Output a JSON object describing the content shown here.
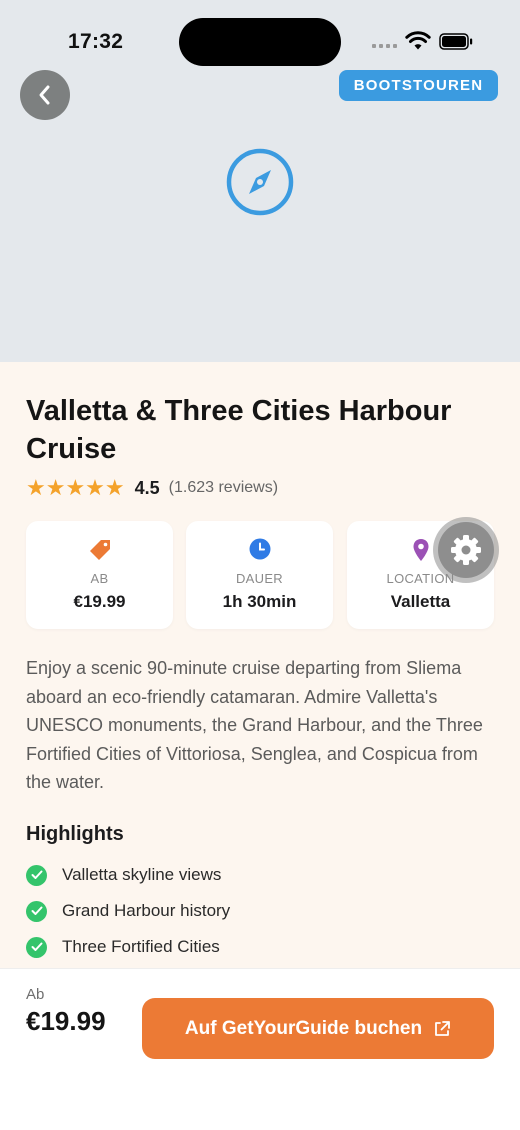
{
  "status_bar": {
    "time": "17:32"
  },
  "hero": {
    "category_badge": "BOOTSTOUREN",
    "icon": "compass-icon"
  },
  "tour": {
    "title": "Valletta & Three Cities Harbour Cruise",
    "rating": {
      "stars": "★★★★★",
      "value": "4.5",
      "count": "(1.623 reviews)"
    },
    "info_cards": [
      {
        "icon": "price-tag-icon",
        "label": "AB",
        "value": "€19.99"
      },
      {
        "icon": "clock-icon",
        "label": "DAUER",
        "value": "1h 30min"
      },
      {
        "icon": "location-pin-icon",
        "label": "LOCATION",
        "value": "Valletta"
      }
    ],
    "description": "Enjoy a scenic 90-minute cruise departing from Sliema aboard an eco-friendly catamaran. Admire Valletta's UNESCO monuments, the Grand Harbour, and the Three Fortified Cities of Vittoriosa, Senglea, and Cospicua from the water.",
    "highlights_title": "Highlights",
    "highlights": [
      "Valletta skyline views",
      "Grand Harbour history",
      "Three Fortified Cities"
    ]
  },
  "bottom_bar": {
    "from_label": "Ab",
    "price": "€19.99",
    "book_label": "Auf GetYourGuide buchen"
  },
  "colors": {
    "accent": "#ec7a35",
    "badge": "#3b9be0",
    "hero_bg": "#e4e8ec",
    "content_bg": "#fdf6ef",
    "star": "#f4a22a",
    "check": "#34c46b"
  }
}
